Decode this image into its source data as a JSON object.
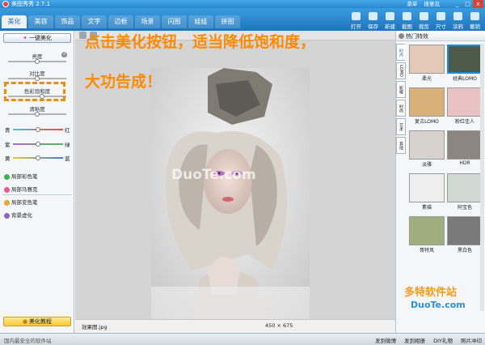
{
  "window": {
    "title": "美图秀秀 2.7.1",
    "links": [
      "菜单",
      "搜意见"
    ],
    "controls": [
      "_",
      "□",
      "x"
    ]
  },
  "nav": {
    "tabs": [
      "美化",
      "美容",
      "饰品",
      "文字",
      "边框",
      "场景",
      "闪图",
      "娃娃",
      "拼图"
    ],
    "active": 0
  },
  "toolbar": [
    "打开",
    "保存",
    "新建",
    "截图",
    "裁剪",
    "尺寸",
    "涂鸦",
    "撤销"
  ],
  "left": {
    "oneclick": "一键美化",
    "sliders": [
      {
        "label": "亮度",
        "value": 0.5
      },
      {
        "label": "对比度",
        "value": 0.5
      },
      {
        "label": "色彩饱和度",
        "value": 0.58
      },
      {
        "label": "清晰度",
        "value": 0.5
      }
    ],
    "color_sliders": [
      {
        "left": "青",
        "right": "红",
        "value": 0.5,
        "colors": [
          "#4ec3d6",
          "#ee4a4a"
        ]
      },
      {
        "left": "紫",
        "right": "绿",
        "value": 0.5,
        "colors": [
          "#b06ad0",
          "#4cbc53"
        ]
      },
      {
        "left": "黄",
        "right": "蓝",
        "value": 0.5,
        "colors": [
          "#e8c83a",
          "#3f7fd9"
        ]
      }
    ],
    "features": [
      {
        "label": "局部彩色笔",
        "color": "#38b54a"
      },
      {
        "label": "局部马赛克",
        "color": "#e85a8c"
      },
      {
        "label": "局部变色笔",
        "color": "#f0a22e"
      },
      {
        "label": "背景虚化",
        "color": "#8f62c9"
      }
    ],
    "tutorial": "美化教程"
  },
  "center": {
    "hint_line1": "点击美化按钮，适当降低饱和度，",
    "hint_line2": "大功告成！",
    "watermark": "DuoTe.com",
    "file_label": "效果图.jpg",
    "dimensions": "450 × 675"
  },
  "right": {
    "header": "热门特效",
    "vtabs": [
      "时尚",
      "LOMO",
      "影楼",
      "时尚",
      "艺术",
      "其他"
    ],
    "effects": [
      "柔光",
      "经典LOMO",
      "复古LOMO",
      "粉红佳人",
      "淡雅",
      "HDR",
      "素描",
      "阿宝色",
      "哥特风",
      "黑白色"
    ]
  },
  "bottom": {
    "left": "国内最安全的软件站",
    "items": [
      "发到微博",
      "发到相册",
      "DIY礼物",
      "照片冲印"
    ]
  },
  "watermark_logo": {
    "text": "多特软件站",
    "url": "DuoTe.com"
  }
}
